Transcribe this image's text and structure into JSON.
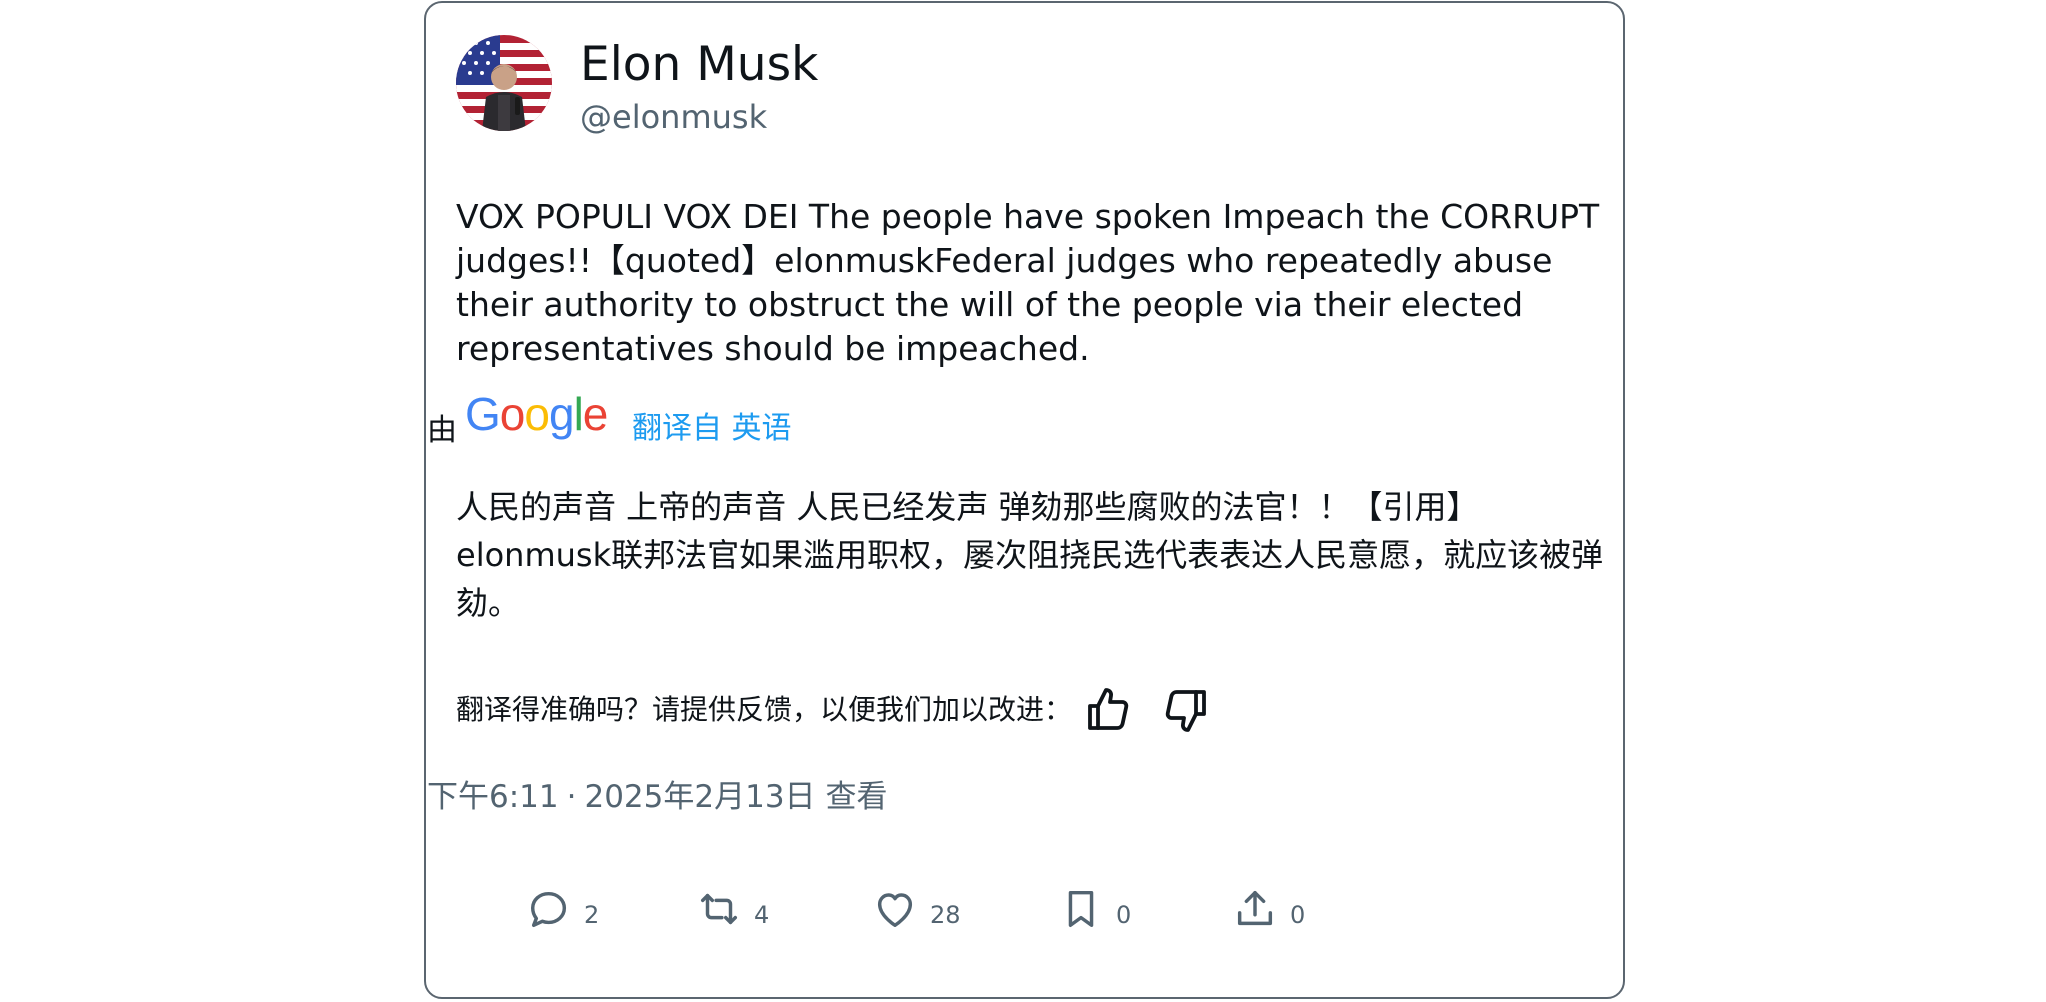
{
  "author": {
    "name": "Elon Musk",
    "handle": "@elonmusk"
  },
  "tweet": {
    "text": "VOX POPULI VOX DEI The people have spoken Impeach the CORRUPT judges!!【quoted】elonmuskFederal judges who repeatedly abuse their authority to obstruct the will of the people via their elected representatives should be impeached."
  },
  "translation_header": {
    "by_label": "由",
    "google_logo": "Google",
    "translated_from": "翻译自 英语"
  },
  "translation": {
    "text": "人民的声音 上帝的声音 人民已经发声 弹劾那些腐败的法官！！【引用】elonmusk联邦法官如果滥用职权，屡次阻挠民选代表表达人民意愿，就应该被弹劾。"
  },
  "feedback": {
    "prompt": "翻译得准确吗？请提供反馈，以便我们加以改进：",
    "thumbs_up_icon": "thumbs-up-icon",
    "thumbs_down_icon": "thumbs-down-icon"
  },
  "meta": {
    "time": "下午6:11",
    "separator": "·",
    "date": "2025年2月13日",
    "view_label": "查看"
  },
  "actions": [
    {
      "icon": "reply-icon",
      "count": "2"
    },
    {
      "icon": "retweet-icon",
      "count": "4"
    },
    {
      "icon": "like-icon",
      "count": "28"
    },
    {
      "icon": "bookmark-icon",
      "count": "0"
    },
    {
      "icon": "share-icon",
      "count": "0"
    }
  ],
  "colors": {
    "text": "#0f1419",
    "secondary": "#536471",
    "link": "#1d9bf0",
    "border": "#5b6670",
    "google_blue": "#4285f4",
    "google_red": "#ea4335",
    "google_yellow": "#fbbc05",
    "google_green": "#34a853"
  }
}
